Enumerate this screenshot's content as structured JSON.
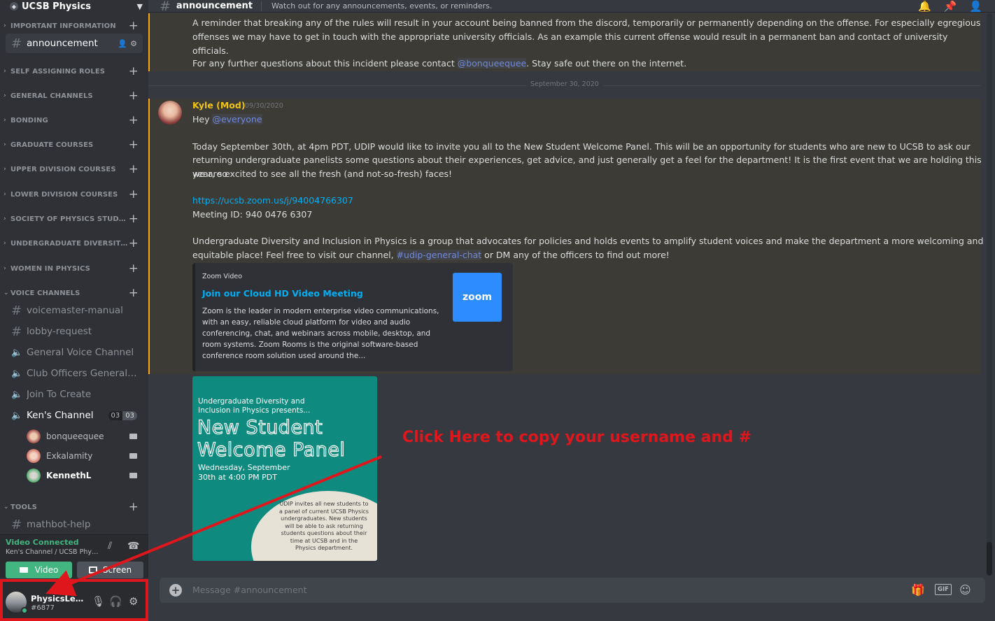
{
  "server": {
    "name": "UCSB Physics"
  },
  "categories": [
    "IMPORTANT INFORMATION",
    "SELF ASSIGNING ROLES",
    "GENERAL CHANNELS",
    "BONDING",
    "GRADUATE COURSES",
    "UPPER DIVISION COURSES",
    "LOWER DIVISION COURSES",
    "SOCIETY OF PHYSICS STUDENTS",
    "UNDERGRADUATE DIVERSITY IN ...",
    "WOMEN IN PHYSICS",
    "VOICE CHANNELS",
    "TOOLS"
  ],
  "channels": {
    "announcement": "announcement",
    "voicemaster_manual": "voicemaster-manual",
    "lobby_request": "lobby-request",
    "general_voice": "General Voice Channel",
    "club_officers": "Club Officers General Vo...",
    "join_to_create": "Join To Create",
    "kens_channel": "Ken's Channel",
    "kens_count_a": "03",
    "kens_count_b": "03",
    "mathbot_help": "mathbot-help"
  },
  "voice_members": [
    "bonqueequee",
    "Exkalamity",
    "KennethL"
  ],
  "voice_panel": {
    "status": "Video Connected",
    "location": "Ken's Channel / UCSB Phys...",
    "video_label": "Video",
    "screen_label": "Screen"
  },
  "user": {
    "name": "PhysicsLege...",
    "tag": "#6877"
  },
  "topbar": {
    "channel": "announcement",
    "topic": "Watch out for any announcements, events, or reminders."
  },
  "messages": {
    "prev_line1": "A reminder that breaking any of the rules will result in your account being banned from the discord, temporarily or permanently depending on the offense. For especially egregious",
    "prev_line2": "offenses we may have to get in touch with the appropriate university officials. As an example this current offense would result in a permanent ban and contact of university officials.",
    "prev_line3_pre": "For any further questions about this incident please contact ",
    "prev_line3_mention": "@bonqueequee",
    "prev_line3_post": ". Stay safe out there on the internet.",
    "divider_date": "September 30, 2020",
    "author": "Kyle (Mod)",
    "timestamp": "09/30/2020",
    "hey": "Hey ",
    "everyone": "@everyone",
    "para1_l1": "Today September 30th, at 4pm PDT, UDIP would like to invite you all to the New Student Welcome Panel. This will be an opportunity for students who are new to UCSB to ask our",
    "para1_l2": "returning undergraduate panelists some questions about their experiences, get advice, and just generally get a feel for the department! It is the first event that we are holding this year, so",
    "para1_l3": "we are excited to see all the fresh (and not-so-fresh) faces!",
    "zoom_link": "https://ucsb.zoom.us/j/94004766307",
    "meeting_id": "Meeting ID: 940 0476 6307",
    "para2_l1": "Undergraduate Diversity and Inclusion in Physics is a group that advocates for policies and holds events to amplify student voices and make the department a more welcoming and",
    "para2_l2_pre": "equitable place! Feel free to visit our channel, ",
    "para2_l2_channel": "#udip-general-chat",
    "para2_l2_post": " or DM any of the officers to find out more!"
  },
  "embed": {
    "provider": "Zoom Video",
    "title": "Join our Cloud HD Video Meeting",
    "description": "Zoom is the leader in modern enterprise video communications, with an easy, reliable cloud platform for video and audio conferencing, chat, and webinars across mobile, desktop, and room systems. Zoom Rooms is the original software-based conference room solution used around the...",
    "thumb_text": "zoom"
  },
  "poster": {
    "intro": "Undergraduate Diversity and Inclusion in Physics presents...",
    "title": "New Student Welcome Panel",
    "date": "Wednesday, September 30th at 4:00 PM PDT",
    "blurb": "UDIP invites all new students to a panel of current UCSB Physics undergraduates. New students will be able to ask returning students questions about their time at UCSB and in the Physics department."
  },
  "annotation": "Click Here to copy your username and #",
  "composer": {
    "placeholder": "Message #announcement",
    "gif_label": "GIF"
  },
  "colors": {
    "annotation_red": "#e0161d",
    "mention_blue": "#7289da",
    "link_blue": "#00aff4",
    "mod_gold": "#f1c40f",
    "online_green": "#43b581"
  }
}
